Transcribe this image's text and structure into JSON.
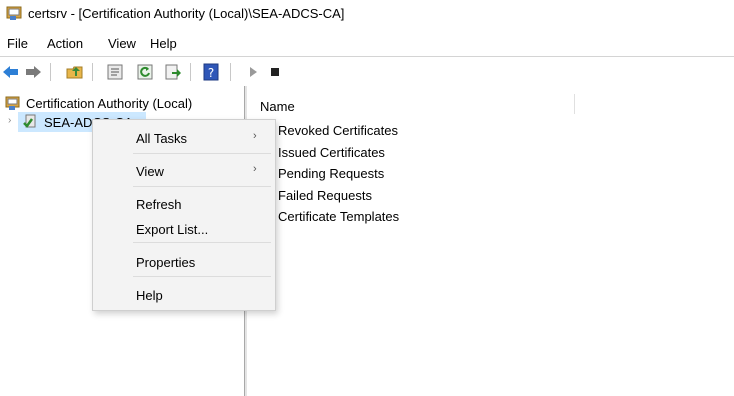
{
  "window": {
    "title": "certsrv - [Certification Authority (Local)\\SEA-ADCS-CA]"
  },
  "menubar": {
    "items": [
      "File",
      "Action",
      "View",
      "Help"
    ]
  },
  "toolbar": {
    "icons": [
      "back-icon",
      "forward-icon",
      "up-folder-icon",
      "properties-icon",
      "refresh-icon",
      "export-icon",
      "help-icon",
      "start-service-icon",
      "stop-service-icon"
    ]
  },
  "tree": {
    "root_label": "Certification Authority (Local)",
    "child_label": "SEA-ADCS-CA"
  },
  "list": {
    "column_name": "Name",
    "rows": [
      "Revoked Certificates",
      "Issued Certificates",
      "Pending Requests",
      "Failed Requests",
      "Certificate Templates"
    ]
  },
  "context_menu": {
    "items": [
      "All Tasks",
      "View",
      "Refresh",
      "Export List...",
      "Properties",
      "Help"
    ],
    "submenu_arrow": "›"
  },
  "colors": {
    "selection": "#cce8ff",
    "menu_bg": "#f3f3f3",
    "accent_blue": "#1f6fd1"
  }
}
